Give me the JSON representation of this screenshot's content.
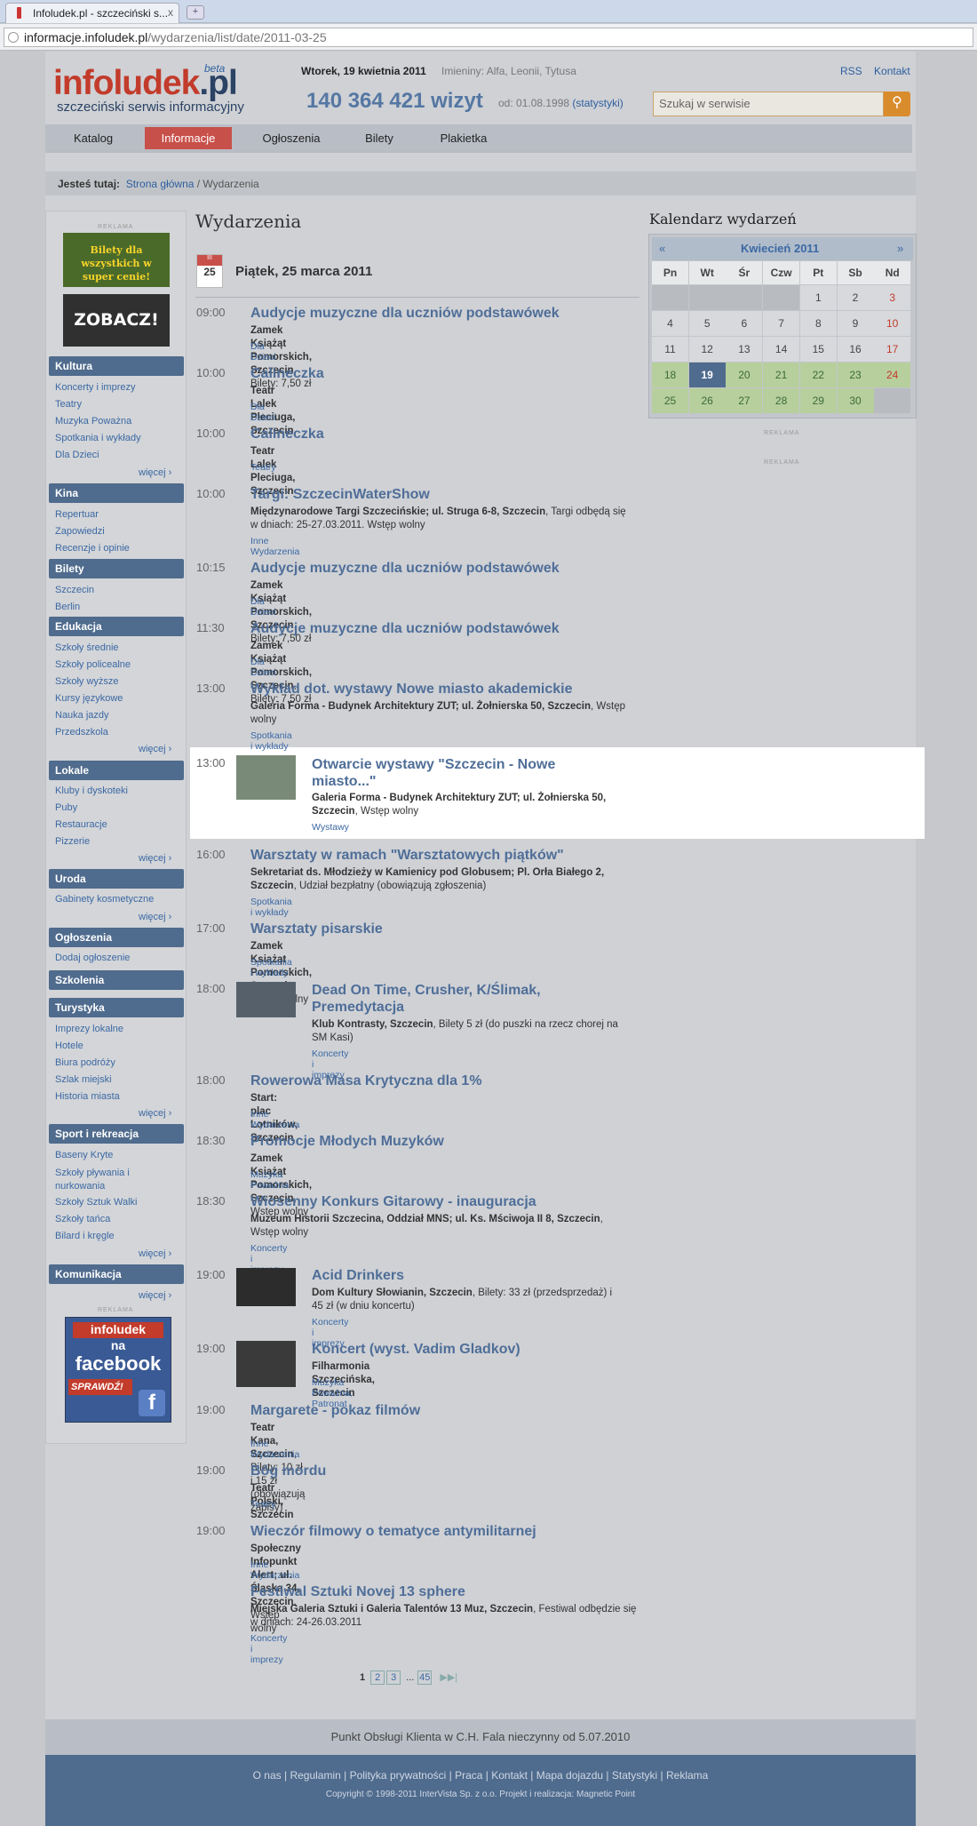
{
  "browser": {
    "tab_title": "Infoludek.pl - szczeciński s...",
    "tab_close": "x",
    "new_tab": "+",
    "url_domain": "informacje.infoludek.pl",
    "url_path": "/wydarzenia/list/date/2011-03-25"
  },
  "header": {
    "logo_main": "infoludek",
    "logo_tld": ".pl",
    "logo_beta": "beta",
    "tagline": "szczeciński serwis informacyjny",
    "date": "Wtorek, 19 kwietnia 2011",
    "namedays": "Imieniny: Alfa, Leonii, Tytusa",
    "visits": "140 364 421 wizyt",
    "since": "od: 01.08.1998",
    "stats_link": "(statystyki)",
    "rss": "RSS",
    "contact": "Kontakt",
    "search_placeholder": "Szukaj w serwisie"
  },
  "nav": [
    "Katalog",
    "Informacje",
    "Ogłoszenia",
    "Bilety",
    "Plakietka"
  ],
  "breadcrumb": {
    "label": "Jesteś tutaj:",
    "home": "Strona główna",
    "current": "/ Wydarzenia"
  },
  "sidebar": {
    "reklama": "REKLAMA",
    "ad1_text": "Bilety dla wszystkich w super cenie!",
    "ad2_text": "ZOBACZ!",
    "more": "więcej ›",
    "fb_ad": {
      "line1": "infoludek",
      "line2": "na",
      "line3": "facebook",
      "cta": "SPRAWDŹ!"
    },
    "sections": [
      {
        "name": "Kultura",
        "items": [
          "Koncerty i imprezy",
          "Teatry",
          "Muzyka Poważna",
          "Spotkania i wykłady",
          "Dla Dzieci"
        ]
      },
      {
        "name": "Kina",
        "items": [
          "Repertuar",
          "Zapowiedzi",
          "Recenzje i opinie"
        ]
      },
      {
        "name": "Bilety",
        "items": [
          "Szczecin",
          "Berlin"
        ]
      },
      {
        "name": "Edukacja",
        "items": [
          "Szkoły średnie",
          "Szkoły policealne",
          "Szkoły wyższe",
          "Kursy językowe",
          "Nauka jazdy",
          "Przedszkola"
        ]
      },
      {
        "name": "Lokale",
        "items": [
          "Kluby i dyskoteki",
          "Puby",
          "Restauracje",
          "Pizzerie"
        ]
      },
      {
        "name": "Uroda",
        "items": [
          "Gabinety kosmetyczne"
        ]
      },
      {
        "name": "Ogłoszenia",
        "items": [
          "Dodaj ogłoszenie"
        ]
      },
      {
        "name": "Szkolenia",
        "items": []
      },
      {
        "name": "Turystyka",
        "items": [
          "Imprezy lokalne",
          "Hotele",
          "Biura podróży",
          "Szlak miejski",
          "Historia miasta"
        ]
      },
      {
        "name": "Sport i rekreacja",
        "items": [
          "Baseny Kryte",
          "Szkoły pływania i nurkowania",
          "Szkoły Sztuk Walki",
          "Szkoły tańca",
          "Bilard i kręgle"
        ]
      },
      {
        "name": "Komunikacja",
        "items": []
      }
    ]
  },
  "main": {
    "title": "Wydarzenia",
    "cal_month": "III",
    "cal_day": "25",
    "day_heading": "Piątek, 25 marca 2011",
    "events": [
      {
        "time": "09:00",
        "title": "Audycje muzyczne dla uczniów podstawówek",
        "loc_bold": "Zamek Książąt Pomorskich, Szczecin",
        "loc_rest": ", Bilety: 7,50 zł",
        "category": "Dla Dzieci"
      },
      {
        "time": "10:00",
        "title": "Calineczka",
        "loc_bold": "Teatr Lalek Pleciuga, Szczecin",
        "loc_rest": "",
        "category": "Dla Dzieci"
      },
      {
        "time": "10:00",
        "title": "Calineczka",
        "loc_bold": "Teatr Lalek Pleciuga, Szczecin",
        "loc_rest": "",
        "category": "Teatry"
      },
      {
        "time": "10:00",
        "title": "Targi: SzczecinWaterShow",
        "loc_bold": "Międzynarodowe Targi Szczecińskie; ul. Struga 6-8, Szczecin",
        "loc_rest": ", Targi odbędą się w dniach: 25-27.03.2011. Wstęp wolny",
        "category": "Inne Wydarzenia"
      },
      {
        "time": "10:15",
        "title": "Audycje muzyczne dla uczniów podstawówek",
        "loc_bold": "Zamek Książąt Pomorskich, Szczecin",
        "loc_rest": ", Bilety: 7,50 zł",
        "category": "Dla Dzieci"
      },
      {
        "time": "11:30",
        "title": "Audycje muzyczne dla uczniów podstawówek",
        "loc_bold": "Zamek Książąt Pomorskich, Szczecin",
        "loc_rest": ", Bilety: 7,50 zł",
        "category": "Dla Dzieci"
      },
      {
        "time": "13:00",
        "title": "Wykład dot. wystawy Nowe miasto akademickie",
        "loc_bold": "Galeria Forma - Budynek Architektury ZUT; ul. Żołnierska 50, Szczecin",
        "loc_rest": ", Wstęp wolny",
        "category": "Spotkania i wykłady"
      },
      {
        "time": "13:00",
        "title": "Otwarcie wystawy \"Szczecin - Nowe miasto...\"",
        "loc_bold": "Galeria Forma - Budynek Architektury ZUT; ul. Żołnierska 50, Szczecin",
        "loc_rest": ", Wstęp wolny",
        "category": "Wystawy"
      },
      {
        "time": "16:00",
        "title": "Warsztaty w ramach \"Warsztatowych piątków\"",
        "loc_bold": "Sekretariat ds. Młodzieży w Kamienicy pod Globusem; Pl. Orła Białego 2, Szczecin",
        "loc_rest": ", Udział bezpłatny (obowiązują zgłoszenia)",
        "category": "Spotkania i wykłady"
      },
      {
        "time": "17:00",
        "title": "Warsztaty pisarskie",
        "loc_bold": "Zamek Książąt Pomorskich, Szczecin",
        "loc_rest": ", Wstęp wolny",
        "category": "Spotkania i wykłady"
      },
      {
        "time": "18:00",
        "title": "Dead On Time, Crusher, K/Ślimak, Premedytacja",
        "loc_bold": "Klub Kontrasty, Szczecin",
        "loc_rest": ", Bilety 5 zł (do puszki na rzecz chorej na SM Kasi)",
        "category": "Koncerty i imprezy"
      },
      {
        "time": "18:00",
        "title": "Rowerowa Masa Krytyczna dla 1%",
        "loc_bold": "Start: plac Lotników, Szczecin",
        "loc_rest": "",
        "category": "Inne Wydarzenia"
      },
      {
        "time": "18:30",
        "title": "Promocje Młodych Muzyków",
        "loc_bold": "Zamek Książąt Pomorskich, Szczecin",
        "loc_rest": ", Wstęp wolny",
        "category": "Muzyka Poważna"
      },
      {
        "time": "18:30",
        "title": "Wiosenny Konkurs Gitarowy - inauguracja",
        "loc_bold": "Muzeum Historii Szczecina, Oddział MNS; ul. Ks. Mściwoja II 8, Szczecin",
        "loc_rest": ", Wstęp wolny",
        "category": "Koncerty i imprezy"
      },
      {
        "time": "19:00",
        "title": "Acid Drinkers",
        "loc_bold": "Dom Kultury Słowianin, Szczecin",
        "loc_rest": ", Bilety: 33 zł (przedsprzedaż) i 45 zł (w dniu koncertu)",
        "category": "Koncerty i imprezy"
      },
      {
        "time": "19:00",
        "title": "Koncert (wyst. Vadim Gladkov)",
        "loc_bold": "Filharmonia Szczecińska, Szczecin",
        "loc_rest": "",
        "category": "Muzyka Poważna, Patronat"
      },
      {
        "time": "19:00",
        "title": "Margarete - pokaz filmów",
        "loc_bold": "Teatr Kana, Szczecin",
        "loc_rest": ", Bilety: 10 zł i 15 zł (obowiązują zapisy)",
        "category": "Inne Wydarzenia"
      },
      {
        "time": "19:00",
        "title": "Bóg mordu",
        "loc_bold": "Teatr Polski, Szczecin",
        "loc_rest": "",
        "category": "Teatry"
      },
      {
        "time": "19:00",
        "title": "Wieczór filmowy o tematyce antymilitarnej",
        "loc_bold": "Społeczny Infopunkt Alert; ul. Śląska 34, Szczecin",
        "loc_rest": ", Wstęp wolny",
        "category": "Inne Wydarzenia"
      },
      {
        "time": "",
        "title": "Festiwal Sztuki Novej 13 sphere",
        "loc_bold": "Miejska Galeria Sztuki i Galeria Talentów 13 Muz, Szczecin",
        "loc_rest": ", Festiwal odbędzie się w dniach: 24-26.03.2011",
        "category": "Koncerty i imprezy"
      }
    ],
    "pager": [
      "1",
      "2",
      "3",
      "...",
      "45"
    ]
  },
  "calendar": {
    "title": "Kalendarz wydarzeń",
    "month": "Kwiecień 2011",
    "prev": "«",
    "next": "»",
    "weekdays": [
      "Pn",
      "Wt",
      "Śr",
      "Czw",
      "Pt",
      "Sb",
      "Nd"
    ],
    "days": [
      "",
      "",
      "",
      "",
      "1",
      "2",
      "3",
      "4",
      "5",
      "6",
      "7",
      "8",
      "9",
      "10",
      "11",
      "12",
      "13",
      "14",
      "15",
      "16",
      "17",
      "18",
      "19",
      "20",
      "21",
      "22",
      "23",
      "24",
      "25",
      "26",
      "27",
      "28",
      "29",
      "30",
      ""
    ],
    "today": "19",
    "reklama": "REKLAMA"
  },
  "footer": {
    "notice": "Punkt Obsługi Klienta w C.H. Fala nieczynny od 5.07.2010",
    "links": "O nas | Regulamin | Polityka prywatności | Praca | Kontakt | Mapa dojazdu | Statystyki | Reklama",
    "copyright": "Copyright © 1998-2011 InterVista Sp. z o.o. Projekt i realizacja: Magnetic Point"
  }
}
